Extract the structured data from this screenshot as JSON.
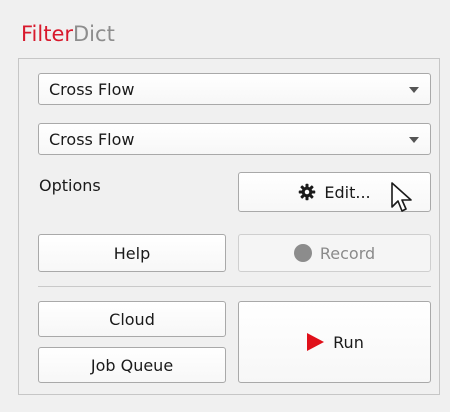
{
  "title": {
    "part1": "Filter",
    "part2": "Dict"
  },
  "combos": [
    {
      "value": "Cross Flow",
      "icon": "chevron-down-icon"
    },
    {
      "value": "Cross Flow",
      "icon": "chevron-down-icon"
    }
  ],
  "options_label": "Options",
  "buttons": {
    "edit": "Edit...",
    "help": "Help",
    "record": "Record",
    "cloud": "Cloud",
    "job_queue": "Job Queue",
    "run": "Run"
  },
  "colors": {
    "brand_red": "#d8192c",
    "play_red": "#e0101a",
    "record_gray": "#8c8c8c"
  }
}
